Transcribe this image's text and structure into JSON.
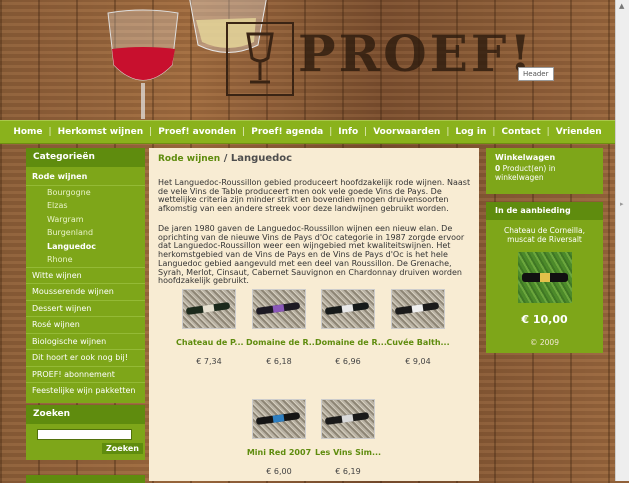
{
  "header": {
    "logo_text": "PROEF!",
    "badge": "Header"
  },
  "nav": {
    "items": [
      "Home",
      "Herkomst wijnen",
      "Proef! avonden",
      "Proef! agenda",
      "Info",
      "Voorwaarden",
      "Log in",
      "Contact",
      "Vrienden"
    ],
    "separator": "|"
  },
  "sidebar": {
    "categories_title": "Categorieën",
    "categories": [
      {
        "label": "Rode wijnen",
        "level": 0,
        "active": true
      },
      {
        "label": "Bourgogne",
        "level": 1
      },
      {
        "label": "Elzas",
        "level": 1
      },
      {
        "label": "Wargram",
        "level": 1
      },
      {
        "label": "Burgenland",
        "level": 1
      },
      {
        "label": "Languedoc",
        "level": 1,
        "active": true
      },
      {
        "label": "Rhone",
        "level": 1
      },
      {
        "label": "Witte wijnen",
        "level": 0
      },
      {
        "label": "Mousserende wijnen",
        "level": 0
      },
      {
        "label": "Dessert wijnen",
        "level": 0
      },
      {
        "label": "Rosé wijnen",
        "level": 0
      },
      {
        "label": "Biologische wijnen",
        "level": 0
      },
      {
        "label": "Dit hoort er ook nog bij!",
        "level": 0
      },
      {
        "label": "PROEF! abonnement",
        "level": 0
      },
      {
        "label": "Feestelijke wijn pakketten",
        "level": 0
      }
    ],
    "search_title": "Zoeken",
    "search_value": "",
    "search_button": "Zoeken"
  },
  "main": {
    "breadcrumb_link": "Rode wijnen",
    "breadcrumb_sep": "/",
    "breadcrumb_current": "Languedoc",
    "paragraph1": "Het Languedoc-Roussillon gebied produceert hoofdzakelijk rode wijnen. Naast de vele Vins de Table produceert men ook vele goede Vins de Pays. De wettelijke criteria zijn minder strikt en bovendien mogen druivensoorten afkomstig van een andere streek voor deze landwijnen gebruikt worden.",
    "paragraph2": "De jaren 1980 gaven de Languedoc-Roussillon wijnen een nieuw elan. De oprichting van de nieuwe Vins de Pays d'Oc categorie in 1987 zorgde ervoor dat Languedoc-Roussillon weer een wijngebied met kwaliteitswijnen. Het herkomstgebied van de Vins de Pays en de Vins de Pays d'Oc is het hele Languedoc gebied aangevuld met een deel van Roussillon. De Grenache, Syrah, Merlot, Cinsaut, Cabernet Sauvignon en Chardonnay druiven worden hoofdzakelijk gebruikt.",
    "products": [
      {
        "name": "Chateau de P...",
        "price": "€ 7,34",
        "bottle_color": "#1c2a1c",
        "label_color": "#e6e0d0"
      },
      {
        "name": "Domaine de R...",
        "price": "€ 6,18",
        "bottle_color": "#1d1a24",
        "label_color": "#8a58b8"
      },
      {
        "name": "Domaine de R...",
        "price": "€ 6,96",
        "bottle_color": "#161a1a",
        "label_color": "#e8e8e8"
      },
      {
        "name": "Cuvée Balth...",
        "price": "€ 9,04",
        "bottle_color": "#1b1b1b",
        "label_color": "#efefef"
      },
      {
        "name": "Mini Red 2007",
        "price": "€ 6,00",
        "bottle_color": "#151515",
        "label_color": "#2f7fc0"
      },
      {
        "name": "Les Vins Sim...",
        "price": "€ 6,19",
        "bottle_color": "#1a1a1a",
        "label_color": "#d9d9d9"
      }
    ]
  },
  "right": {
    "cart_title": "Winkelwagen",
    "cart_count": "0",
    "cart_text": "Product(en) in winkelwagen",
    "offer_title": "In de aanbieding",
    "offer_name": "Chateau de Corneilla, muscat de Riversalt",
    "offer_price": "€ 10,00",
    "copyright": "© 2009"
  },
  "colors": {
    "accent_green": "#7ea619",
    "dark_green": "#5f8c0e",
    "content_bg": "#f8ecd3",
    "wood": "#8a5c36"
  }
}
